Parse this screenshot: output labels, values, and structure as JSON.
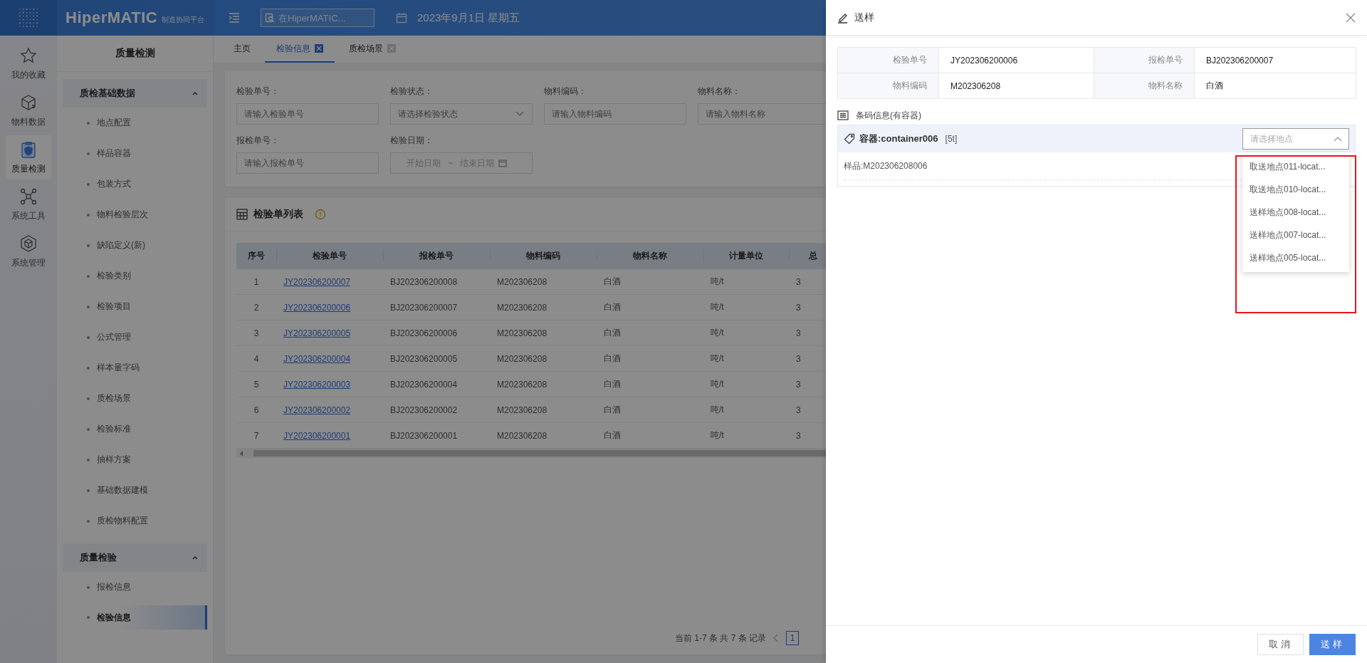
{
  "topbar": {
    "logo": "HiperMATIC",
    "logo_subtitle": "制造协同平台",
    "search": {
      "placeholder": "在HiperMATIC..."
    },
    "date": "2023年9月1日 星期五"
  },
  "rail": [
    {
      "label": "我的收藏",
      "kind": "star",
      "selected": false
    },
    {
      "label": "物料数据",
      "kind": "box",
      "selected": false
    },
    {
      "label": "质量检测",
      "kind": "shield",
      "selected": true
    },
    {
      "label": "系统工具",
      "kind": "network",
      "selected": false
    },
    {
      "label": "系统管理",
      "kind": "cube",
      "selected": false
    }
  ],
  "sidebar": {
    "title": "质量检测",
    "groups": [
      {
        "label": "质检基础数据",
        "expanded": true,
        "children": [
          {
            "label": "地点配置",
            "selected": false
          },
          {
            "label": "样品容器",
            "selected": false
          },
          {
            "label": "包装方式",
            "selected": false
          },
          {
            "label": "物料检验层次",
            "selected": false
          },
          {
            "label": "缺陷定义(新)",
            "selected": false
          },
          {
            "label": "检验类别",
            "selected": false
          },
          {
            "label": "检验项目",
            "selected": false
          },
          {
            "label": "公式管理",
            "selected": false
          },
          {
            "label": "样本量字码",
            "selected": false
          },
          {
            "label": "质检场景",
            "selected": false
          },
          {
            "label": "检验标准",
            "selected": false
          },
          {
            "label": "抽样方案",
            "selected": false
          },
          {
            "label": "基础数据建模",
            "selected": false
          },
          {
            "label": "质检物料配置",
            "selected": false
          }
        ]
      },
      {
        "label": "质量检验",
        "expanded": true,
        "children": [
          {
            "label": "报检信息",
            "selected": false
          },
          {
            "label": "检验信息",
            "selected": true
          }
        ]
      }
    ]
  },
  "tabs": [
    {
      "label": "主页",
      "selected": false,
      "closable": false
    },
    {
      "label": "检验信息",
      "selected": true,
      "closable": true
    },
    {
      "label": "质检场景",
      "selected": false,
      "closable": true
    }
  ],
  "filters": [
    {
      "label": "检验单号：",
      "kind": "text",
      "placeholder": "请输入检验单号"
    },
    {
      "label": "检验状态：",
      "kind": "select",
      "placeholder": "请选择检验状态"
    },
    {
      "label": "物料编码：",
      "kind": "text",
      "placeholder": "请输入物料编码"
    },
    {
      "label": "物料名称：",
      "kind": "text",
      "placeholder": "请输入物料名称"
    },
    {
      "label": "报检单号：",
      "kind": "text",
      "placeholder": "请输入报检单号"
    },
    {
      "label": "检验日期：",
      "kind": "daterange",
      "start_placeholder": "开始日期",
      "separator": "~",
      "end_placeholder": "结束日期"
    }
  ],
  "list": {
    "title": "检验单列表",
    "columns": [
      {
        "label": "序号",
        "kind": "index"
      },
      {
        "label": "检验单号",
        "kind": "link"
      },
      {
        "label": "报检单号",
        "kind": "text"
      },
      {
        "label": "物料编码",
        "kind": "text"
      },
      {
        "label": "物料名称",
        "kind": "text"
      },
      {
        "label": "计量单位",
        "kind": "text"
      },
      {
        "label": "总",
        "kind": "text"
      }
    ],
    "rows": [
      [
        "1",
        "JY202306200007",
        "BJ202306200008",
        "M202306208",
        "白酒",
        "吨/t",
        "3"
      ],
      [
        "2",
        "JY202306200006",
        "BJ202306200007",
        "M202306208",
        "白酒",
        "吨/t",
        "3"
      ],
      [
        "3",
        "JY202306200005",
        "BJ202306200006",
        "M202306208",
        "白酒",
        "吨/t",
        "3"
      ],
      [
        "4",
        "JY202306200004",
        "BJ202306200005",
        "M202306208",
        "白酒",
        "吨/t",
        "3"
      ],
      [
        "5",
        "JY202306200003",
        "BJ202306200004",
        "M202306208",
        "白酒",
        "吨/t",
        "3"
      ],
      [
        "6",
        "JY202306200002",
        "BJ202306200002",
        "M202306208",
        "白酒",
        "吨/t",
        "3"
      ],
      [
        "7",
        "JY202306200001",
        "BJ202306200001",
        "M202306208",
        "白酒",
        "吨/t",
        "3"
      ]
    ],
    "pagination": {
      "summary": "当前 1-7 条 共 7 条 记录",
      "pages": [
        {
          "label": "1",
          "selected": true
        }
      ]
    }
  },
  "drawer": {
    "title": "送样",
    "info": [
      {
        "label": "检验单号",
        "value": "JY202306200006"
      },
      {
        "label": "报检单号",
        "value": "BJ202306200007"
      },
      {
        "label": "物料编码",
        "value": "M202306208"
      },
      {
        "label": "物料名称",
        "value": "白酒"
      }
    ],
    "section_title": "条码信息(有容器)",
    "container": {
      "label": "容器:container006",
      "tag": "[5t]",
      "samples": [
        "样品:M202306208006"
      ],
      "location_select": {
        "placeholder": "请选择地点",
        "expanded": true,
        "options": [
          "取送地点011-locat...",
          "取送地点010-locat...",
          "送样地点008-locat...",
          "送样地点007-locat...",
          "送样地点005-locat..."
        ]
      }
    },
    "annotation": {
      "kind": "highlight"
    },
    "buttons": [
      {
        "label": "取消",
        "kind": "secondary"
      },
      {
        "label": "送样",
        "kind": "primary"
      }
    ]
  }
}
